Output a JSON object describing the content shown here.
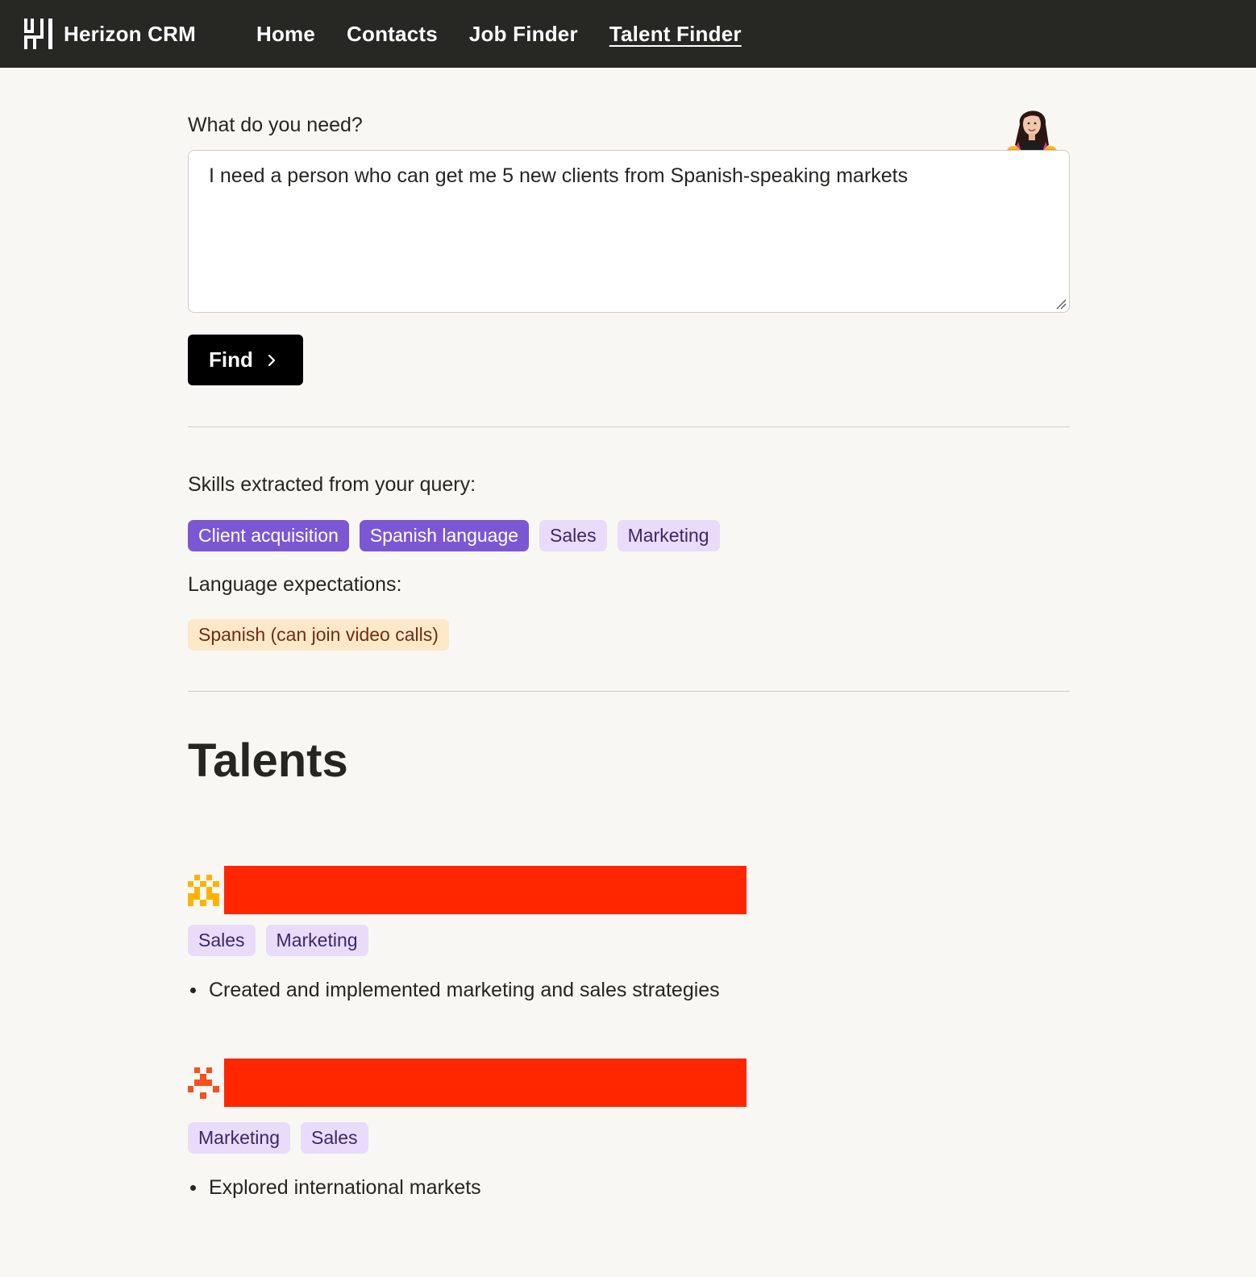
{
  "app": {
    "name": "Herizon CRM",
    "logo_icon": "herizon-logo-icon"
  },
  "nav": {
    "items": [
      {
        "label": "Home",
        "active": false
      },
      {
        "label": "Contacts",
        "active": false
      },
      {
        "label": "Job Finder",
        "active": false
      },
      {
        "label": "Talent Finder",
        "active": true
      }
    ]
  },
  "query": {
    "label": "What do you need?",
    "value": "I need a person who can get me 5 new clients from Spanish-speaking markets",
    "find_label": "Find",
    "find_icon": "chevron-right-icon"
  },
  "skills": {
    "label": "Skills extracted from your query:",
    "tags": [
      {
        "label": "Client acquisition",
        "style": "strong"
      },
      {
        "label": "Spanish language",
        "style": "strong"
      },
      {
        "label": "Sales",
        "style": "soft"
      },
      {
        "label": "Marketing",
        "style": "soft"
      }
    ]
  },
  "languages": {
    "label": "Language expectations:",
    "tags": [
      {
        "label": "Spanish (can join video calls)"
      }
    ]
  },
  "talents": {
    "title": "Talents",
    "items": [
      {
        "icon": "pixel-identicon-orange",
        "tags": [
          "Sales",
          "Marketing"
        ],
        "highlights": [
          "Created and implemented marketing and sales strategies"
        ]
      },
      {
        "icon": "pixel-identicon-red",
        "tags": [
          "Marketing",
          "Sales"
        ],
        "highlights": [
          "Explored international markets"
        ]
      }
    ]
  },
  "colors": {
    "topbar": "#272723",
    "background": "#f8f7f3",
    "tag_strong": "#7b57d4",
    "tag_soft": "#e8dcfa",
    "tag_language": "#fde8c8",
    "redaction": "#ff2600",
    "identicon_orange": "#ffb300",
    "identicon_red": "#f4511e"
  }
}
